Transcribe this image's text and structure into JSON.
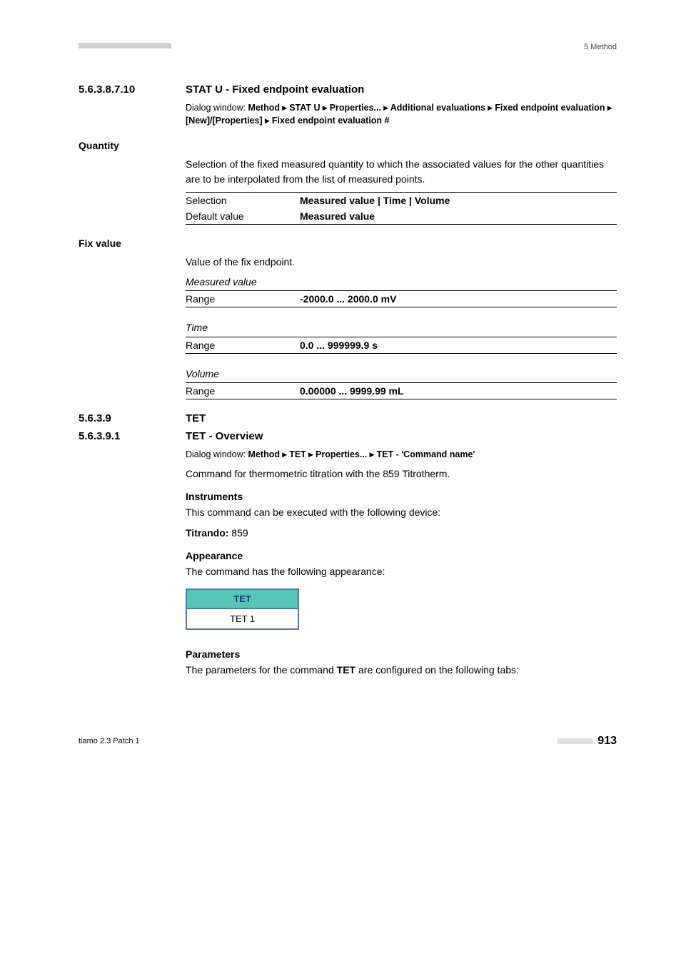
{
  "header": {
    "right": "5 Method"
  },
  "sec1": {
    "num": "5.6.3.8.7.10",
    "title": "STAT U - Fixed endpoint evaluation",
    "dialog_prefix": "Dialog window: ",
    "dialog_path": "Method ▸ STAT U ▸ Properties... ▸ Additional evaluations ▸ Fixed endpoint evaluation ▸ [New]/[Properties] ▸ Fixed endpoint evaluation #"
  },
  "quantity": {
    "label": "Quantity",
    "desc": "Selection of the fixed measured quantity to which the associated values for the other quantities are to be interpolated from the list of measured points.",
    "row1_k": "Selection",
    "row1_v": "Measured value | Time | Volume",
    "row2_k": "Default value",
    "row2_v": "Measured value"
  },
  "fixvalue": {
    "label": "Fix value",
    "desc": "Value of the fix endpoint.",
    "grp1_title": "Measured value",
    "grp1_k": "Range",
    "grp1_v": "-2000.0 ... 2000.0 mV",
    "grp2_title": "Time",
    "grp2_k": "Range",
    "grp2_v": "0.0 ... 999999.9 s",
    "grp3_title": "Volume",
    "grp3_k": "Range",
    "grp3_v": "0.00000 ... 9999.99 mL"
  },
  "sec2": {
    "num": "5.6.3.9",
    "title": "TET"
  },
  "sec3": {
    "num": "5.6.3.9.1",
    "title": "TET - Overview",
    "dialog_prefix": "Dialog window: ",
    "dialog_path": "Method ▸ TET ▸ Properties... ▸ TET - 'Command name'",
    "line1": "Command for thermometric titration with the 859 Titrotherm.",
    "instr_h": "Instruments",
    "instr_line": "This command can be executed with the following device:",
    "titrando_lbl": "Titrando:",
    "titrando_val": " 859",
    "app_h": "Appearance",
    "app_line": "The command has the following appearance:",
    "card_top": "TET",
    "card_bot": "TET 1",
    "param_h": "Parameters",
    "param_line_a": "The parameters for the command ",
    "param_line_b": "TET",
    "param_line_c": " are configured on the following tabs:"
  },
  "footer": {
    "left": "tiamo 2.3 Patch 1",
    "page": "913"
  }
}
